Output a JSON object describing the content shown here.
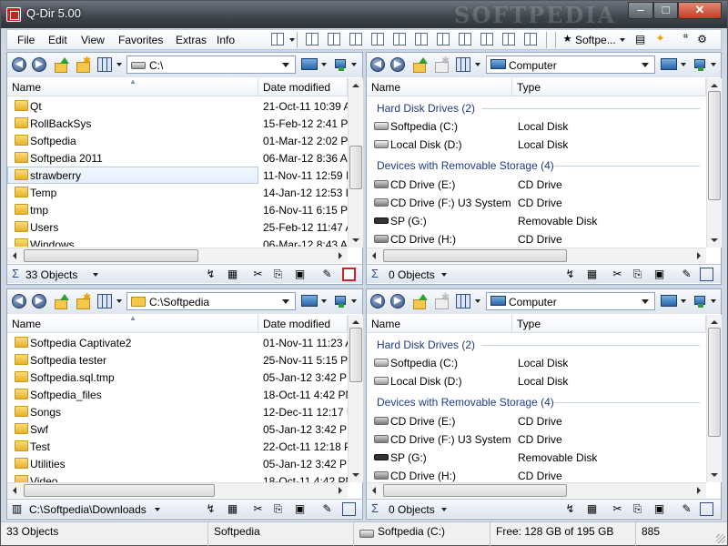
{
  "window": {
    "title": "Q-Dir 5.00",
    "watermark": "SOFTPEDIA",
    "min": "–",
    "max": "□",
    "close": "✕"
  },
  "menu": {
    "items": [
      "File",
      "Edit",
      "View",
      "Favorites",
      "Extras",
      "Info"
    ],
    "favorite_label": "Softpe..."
  },
  "panes": [
    {
      "address": "C:\\",
      "address_icon": "drive-icon",
      "columns": [
        "Name",
        "Date modified"
      ],
      "rows": [
        {
          "name": "Qt",
          "date": "21-Oct-11 10:39 A"
        },
        {
          "name": "RollBackSys",
          "date": "15-Feb-12 2:41 PN"
        },
        {
          "name": "Softpedia",
          "date": "01-Mar-12 2:02 PN"
        },
        {
          "name": "Softpedia 2011",
          "date": "06-Mar-12 8:36 A"
        },
        {
          "name": "strawberry",
          "date": "11-Nov-11 12:59 I",
          "selected": true
        },
        {
          "name": "Temp",
          "date": "14-Jan-12 12:53 P"
        },
        {
          "name": "tmp",
          "date": "16-Nov-11 6:15 P"
        },
        {
          "name": "Users",
          "date": "25-Feb-12 11:47 A"
        },
        {
          "name": "Windows",
          "date": "06-Mar-12 8:43 A"
        }
      ],
      "status": "33 Objects"
    },
    {
      "address": "Computer",
      "address_icon": "computer-icon",
      "columns": [
        "Name",
        "Type"
      ],
      "groups": [
        {
          "label": "Hard Disk Drives (2)",
          "drives": [
            {
              "name": "Softpedia (C:)",
              "type": "Local Disk",
              "icon": "hdd"
            },
            {
              "name": "Local Disk (D:)",
              "type": "Local Disk",
              "icon": "hdd"
            }
          ]
        },
        {
          "label": "Devices with Removable Storage (4)",
          "drives": [
            {
              "name": "CD Drive (E:)",
              "type": "CD Drive",
              "icon": "cd"
            },
            {
              "name": "CD Drive (F:) U3 System",
              "type": "CD Drive",
              "icon": "cd"
            },
            {
              "name": "SP (G:)",
              "type": "Removable Disk",
              "icon": "usb"
            },
            {
              "name": "CD Drive (H:)",
              "type": "CD Drive",
              "icon": "cd"
            }
          ]
        }
      ],
      "status": "0 Objects"
    },
    {
      "address": "C:\\Softpedia",
      "address_icon": "folder-icon",
      "columns": [
        "Name",
        "Date modified"
      ],
      "rows": [
        {
          "name": "Softpedia Captivate2",
          "date": "01-Nov-11 11:23 A"
        },
        {
          "name": "Softpedia tester",
          "date": "25-Nov-11 5:15 P"
        },
        {
          "name": "Softpedia.sql.tmp",
          "date": "05-Jan-12 3:42 PN"
        },
        {
          "name": "Softpedia_files",
          "date": "18-Oct-11 4:42 PN"
        },
        {
          "name": "Songs",
          "date": "12-Dec-11 12:17 P"
        },
        {
          "name": "Swf",
          "date": "05-Jan-12 3:42 PN"
        },
        {
          "name": "Test",
          "date": "22-Oct-11 12:18 P"
        },
        {
          "name": "Utilities",
          "date": "05-Jan-12 3:42 PN"
        },
        {
          "name": "Video",
          "date": "18-Oct-11 4:42 PN"
        }
      ],
      "status": "C:\\Softpedia\\Downloads"
    },
    {
      "address": "Computer",
      "address_icon": "computer-icon",
      "columns": [
        "Name",
        "Type"
      ],
      "groups": [
        {
          "label": "Hard Disk Drives (2)",
          "drives": [
            {
              "name": "Softpedia (C:)",
              "type": "Local Disk",
              "icon": "hdd"
            },
            {
              "name": "Local Disk (D:)",
              "type": "Local Disk",
              "icon": "hdd"
            }
          ]
        },
        {
          "label": "Devices with Removable Storage (4)",
          "drives": [
            {
              "name": "CD Drive (E:)",
              "type": "CD Drive",
              "icon": "cd"
            },
            {
              "name": "CD Drive (F:) U3 System",
              "type": "CD Drive",
              "icon": "cd"
            },
            {
              "name": "SP (G:)",
              "type": "Removable Disk",
              "icon": "usb"
            },
            {
              "name": "CD Drive (H:)",
              "type": "CD Drive",
              "icon": "cd"
            }
          ]
        }
      ],
      "status": "0 Objects"
    }
  ],
  "bottom_status": {
    "objects": "33 Objects",
    "folder": "Softpedia",
    "drive": "Softpedia (C:)",
    "free": "Free: 128 GB of 195 GB",
    "count": "885"
  },
  "colors": {
    "accent": "#2c4f86",
    "group_text": "#1e3b8a",
    "close": "#c23c23"
  }
}
